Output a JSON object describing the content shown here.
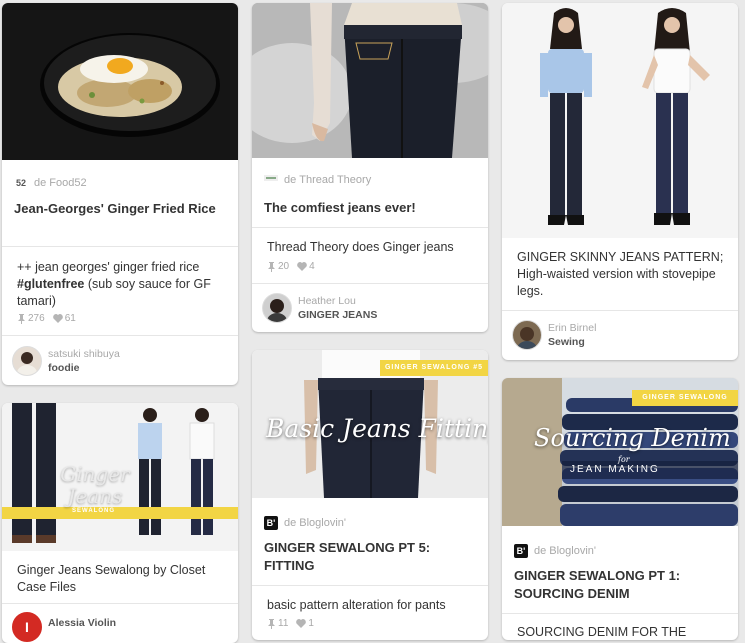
{
  "pins": {
    "rice": {
      "source_prefix": "de",
      "source_name": "Food52",
      "source_logo": "52",
      "title": "Jean-Georges' Ginger Fried Rice",
      "desc_part1": "++ jean georges' ginger fried rice ",
      "desc_tag": "#glutenfree",
      "desc_part2": " (sub soy sauce for GF tamari)",
      "repins": "276",
      "likes": "61",
      "user": "satsuki shibuya",
      "board": "foodie"
    },
    "thread": {
      "source_prefix": "de",
      "source_name": "Thread Theory",
      "title": "The comfiest jeans ever!",
      "desc": "Thread Theory does Ginger jeans",
      "repins": "20",
      "likes": "4",
      "user": "Heather Lou",
      "board": "GINGER JEANS"
    },
    "skinny": {
      "desc": "GINGER SKINNY JEANS PATTERN; High-waisted version with stovepipe legs.",
      "user": "Erin Birnel",
      "board": "Sewing"
    },
    "sewalong": {
      "overlay_title": "Ginger Jeans",
      "overlay_banner": "SEWALONG",
      "desc": "Ginger Jeans Sewalong by Closet Case Files",
      "user": "Alessia Violin",
      "avatar_letter": "I"
    },
    "fitting": {
      "banner": "GINGER SEWALONG #5",
      "overlay_title": "Basic Jeans Fitting",
      "source_prefix": "de",
      "source_name": "Bloglovin'",
      "source_logo": "B'",
      "title": "GINGER SEWALONG PT 5: FITTING",
      "desc": "basic pattern alteration for pants",
      "repins": "11",
      "likes": "1"
    },
    "denim": {
      "banner": "GINGER SEWALONG",
      "overlay_title": "Sourcing Denim",
      "overlay_for": "for",
      "overlay_sub": "JEAN MAKING",
      "source_prefix": "de",
      "source_name": "Bloglovin'",
      "source_logo": "B'",
      "title": "GINGER SEWALONG PT 1: SOURCING DENIM",
      "desc": "SOURCING DENIM FOR THE"
    }
  },
  "icons": {
    "repin": "pin-icon",
    "like": "heart-icon"
  },
  "colors": {
    "banner": "#f2d544",
    "background": "#e9e9e9"
  }
}
